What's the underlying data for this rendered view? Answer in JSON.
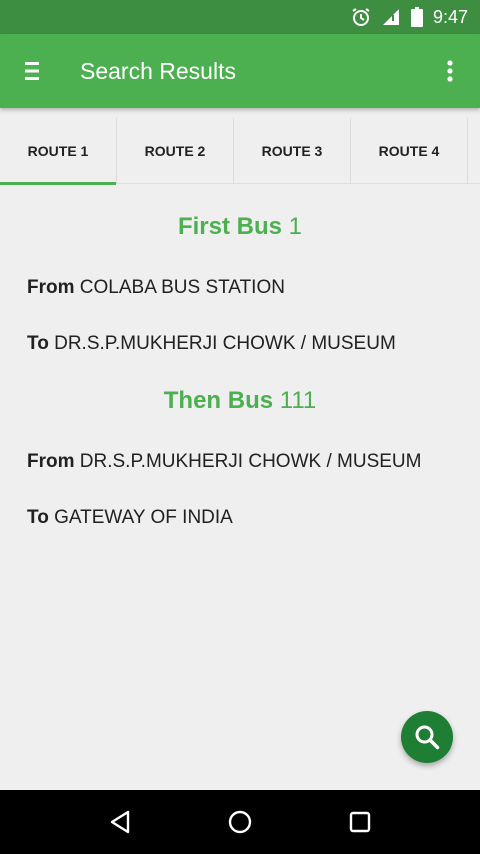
{
  "status_bar": {
    "time": "9:47",
    "icons": [
      "alarm-icon",
      "signal-icon",
      "battery-icon"
    ]
  },
  "app_bar": {
    "title": "Search Results",
    "menu_icon": "menu-icon",
    "overflow_icon": "more-vert-icon"
  },
  "tabs": [
    {
      "label": "ROUTE 1",
      "active": true
    },
    {
      "label": "ROUTE 2",
      "active": false
    },
    {
      "label": "ROUTE 3",
      "active": false
    },
    {
      "label": "ROUTE 4",
      "active": false
    }
  ],
  "route": {
    "first": {
      "heading_label": "First Bus",
      "bus_number": "1",
      "from_label": "From",
      "from_value": "COLABA BUS STATION",
      "to_label": "To",
      "to_value": "DR.S.P.MUKHERJI CHOWK / MUSEUM"
    },
    "then": {
      "heading_label": "Then Bus",
      "bus_number": "111",
      "from_label": "From",
      "from_value": "DR.S.P.MUKHERJI CHOWK / MUSEUM",
      "to_label": "To",
      "to_value": "GATEWAY OF INDIA"
    }
  },
  "fab": {
    "icon": "search-icon"
  },
  "colors": {
    "primary": "#4caf50",
    "primary_dark": "#3e8e41",
    "fab": "#1e7e34",
    "background": "#efefef"
  }
}
